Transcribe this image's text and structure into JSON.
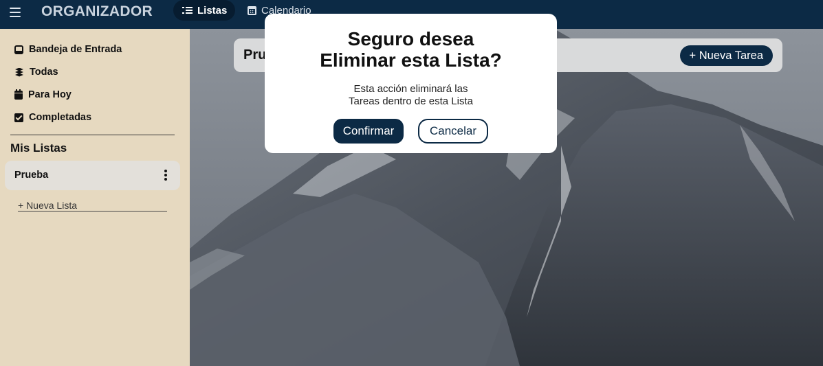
{
  "app": {
    "brand": "ORGANIZADOR"
  },
  "nav": {
    "tabs": [
      {
        "label": "Listas",
        "icon": "list-check-icon",
        "active": true
      },
      {
        "label": "Calendario",
        "icon": "calendar-icon",
        "active": false
      }
    ]
  },
  "sidebar": {
    "items": [
      {
        "label": "Bandeja de Entrada",
        "icon": "inbox-icon"
      },
      {
        "label": "Todas",
        "icon": "layers-icon"
      },
      {
        "label": "Para Hoy",
        "icon": "calendar-day-icon"
      },
      {
        "label": "Completadas",
        "icon": "check-square-icon"
      }
    ],
    "section_title": "Mis Listas",
    "lists": [
      {
        "label": "Prueba"
      }
    ],
    "new_list_label": "+ Nueva Lista"
  },
  "main": {
    "list_title": "Pru",
    "new_task_label": "+ Nueva Tarea"
  },
  "modal": {
    "title_line1": "Seguro desea",
    "title_line2": "Eliminar esta Lista?",
    "text_line1": "Esta acción eliminará las",
    "text_line2": "Tareas dentro de esta Lista",
    "confirm_label": "Confirmar",
    "cancel_label": "Cancelar"
  },
  "colors": {
    "primary": "#0c2a45",
    "sidebar_bg": "#e6d9c0",
    "modal_bg": "#ffffff"
  }
}
